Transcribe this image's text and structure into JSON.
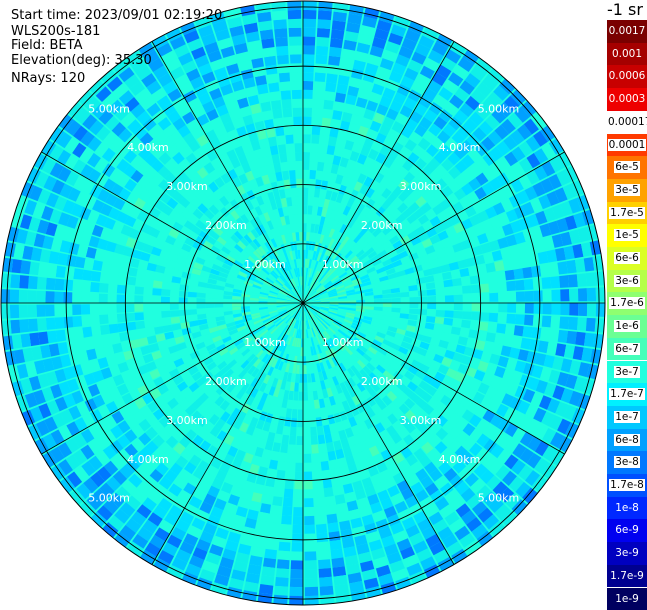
{
  "header": {
    "start_time": "Start time: 2023/09/01 02:19:20",
    "instrument": "WLS200s-181",
    "field": "Field: BETA",
    "elevation": "Elevation(deg): 35.30",
    "nrays": "NRays: 120"
  },
  "colorbar": {
    "units": "-1 sr",
    "levels": [
      {
        "label": "0.0017",
        "color": "#7a0000",
        "text_color": "#ffffff"
      },
      {
        "label": "0.001",
        "color": "#a50000",
        "text_color": "#ffffff"
      },
      {
        "label": "0.0006",
        "color": "#c80000",
        "text_color": "#ffffff"
      },
      {
        "label": "0.0003",
        "color": "#ee0000",
        "text_color": "#ffffff"
      },
      {
        "label": "0.00017",
        "color": "#ffffff",
        "text_color": "#000000"
      },
      {
        "label": "0.0001",
        "color": "#ff3a00",
        "text_color": "#000000"
      },
      {
        "label": "6e-5",
        "color": "#ff7400",
        "text_color": "#000000"
      },
      {
        "label": "3e-5",
        "color": "#ffa200",
        "text_color": "#000000"
      },
      {
        "label": "1.7e-5",
        "color": "#ffd000",
        "text_color": "#000000"
      },
      {
        "label": "1e-5",
        "color": "#ffff00",
        "text_color": "#000000"
      },
      {
        "label": "6e-6",
        "color": "#dbff24",
        "text_color": "#000000"
      },
      {
        "label": "3e-6",
        "color": "#b5ff4a",
        "text_color": "#000000"
      },
      {
        "label": "1.7e-6",
        "color": "#8fff70",
        "text_color": "#000000"
      },
      {
        "label": "1e-6",
        "color": "#6bff94",
        "text_color": "#000000"
      },
      {
        "label": "6e-7",
        "color": "#45ffba",
        "text_color": "#000000"
      },
      {
        "label": "3e-7",
        "color": "#20ffdf",
        "text_color": "#000000"
      },
      {
        "label": "1.7e-7",
        "color": "#00f0ff",
        "text_color": "#000000"
      },
      {
        "label": "1e-7",
        "color": "#00c8ff",
        "text_color": "#000000"
      },
      {
        "label": "6e-8",
        "color": "#00a0ff",
        "text_color": "#000000"
      },
      {
        "label": "3e-8",
        "color": "#0078ff",
        "text_color": "#000000"
      },
      {
        "label": "1.7e-8",
        "color": "#0050ff",
        "text_color": "#000000"
      },
      {
        "label": "1e-8",
        "color": "#0028ff",
        "text_color": "#ffffff"
      },
      {
        "label": "6e-9",
        "color": "#0000f0",
        "text_color": "#ffffff"
      },
      {
        "label": "3e-9",
        "color": "#0000c0",
        "text_color": "#ffffff"
      },
      {
        "label": "1.7e-9",
        "color": "#000090",
        "text_color": "#ffffff"
      },
      {
        "label": "1e-9",
        "color": "#000060",
        "text_color": "#ffffff"
      }
    ]
  },
  "chart_data": {
    "type": "heatmap",
    "projection": "polar (PPI scan)",
    "nrays": 120,
    "range_rings_km": [
      1,
      2,
      3,
      4,
      5
    ],
    "range_ring_labels": [
      "1.00km",
      "2.00km",
      "3.00km",
      "4.00km",
      "5.00km"
    ],
    "max_range_km": 5.1,
    "spokes_deg": [
      0,
      30,
      60,
      90,
      120,
      150,
      180,
      210,
      240,
      270,
      300,
      330
    ],
    "dominant_value_range": [
      "1e-7",
      "3e-7"
    ],
    "outer_value_range": [
      "3e-8",
      "1.7e-7"
    ],
    "center_value_range": [
      "1e-8",
      "1e-6"
    ],
    "grid": true
  }
}
